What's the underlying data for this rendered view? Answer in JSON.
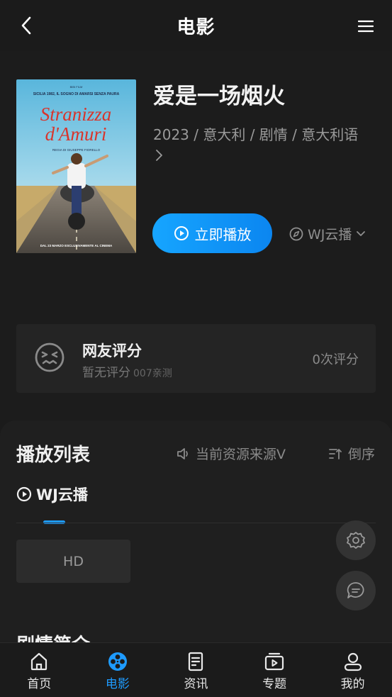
{
  "header": {
    "title": "电影"
  },
  "movie": {
    "title": "爱是一场烟火",
    "meta": "2023 / 意大利 / 剧情 / 意大利语",
    "play_label": "立即播放",
    "source_label": "WJ云播",
    "poster": {
      "top_text": "SICILIA 1982, IL SOGNO DI AMARSI SENZA PAURA",
      "title_line1": "Stranizza",
      "title_line2": "d'Amuri",
      "director": "REGIA DI GIUSEPPE FIORELLO",
      "date": "DAL 23 MARZO ESCLUSIVAMENTE AL CINEMA"
    }
  },
  "rating": {
    "title": "网友评分",
    "subtitle": "暂无评分",
    "subtitle_small": "007亲测",
    "count": "0次评分"
  },
  "playlist": {
    "title": "播放列表",
    "current_source": "当前资源来源V",
    "order_label": "倒序",
    "source_tab": "WJ云播",
    "episodes": [
      "HD"
    ]
  },
  "plot": {
    "title": "剧情简介"
  },
  "tabbar": {
    "items": [
      {
        "label": "首页",
        "icon": "home-icon"
      },
      {
        "label": "电影",
        "icon": "film-reel-icon"
      },
      {
        "label": "资讯",
        "icon": "news-icon"
      },
      {
        "label": "专题",
        "icon": "topic-icon"
      },
      {
        "label": "我的",
        "icon": "user-icon"
      }
    ],
    "active_index": 1
  },
  "colors": {
    "accent": "#1e9bff",
    "background": "#1b1b1b",
    "card": "#242424"
  }
}
